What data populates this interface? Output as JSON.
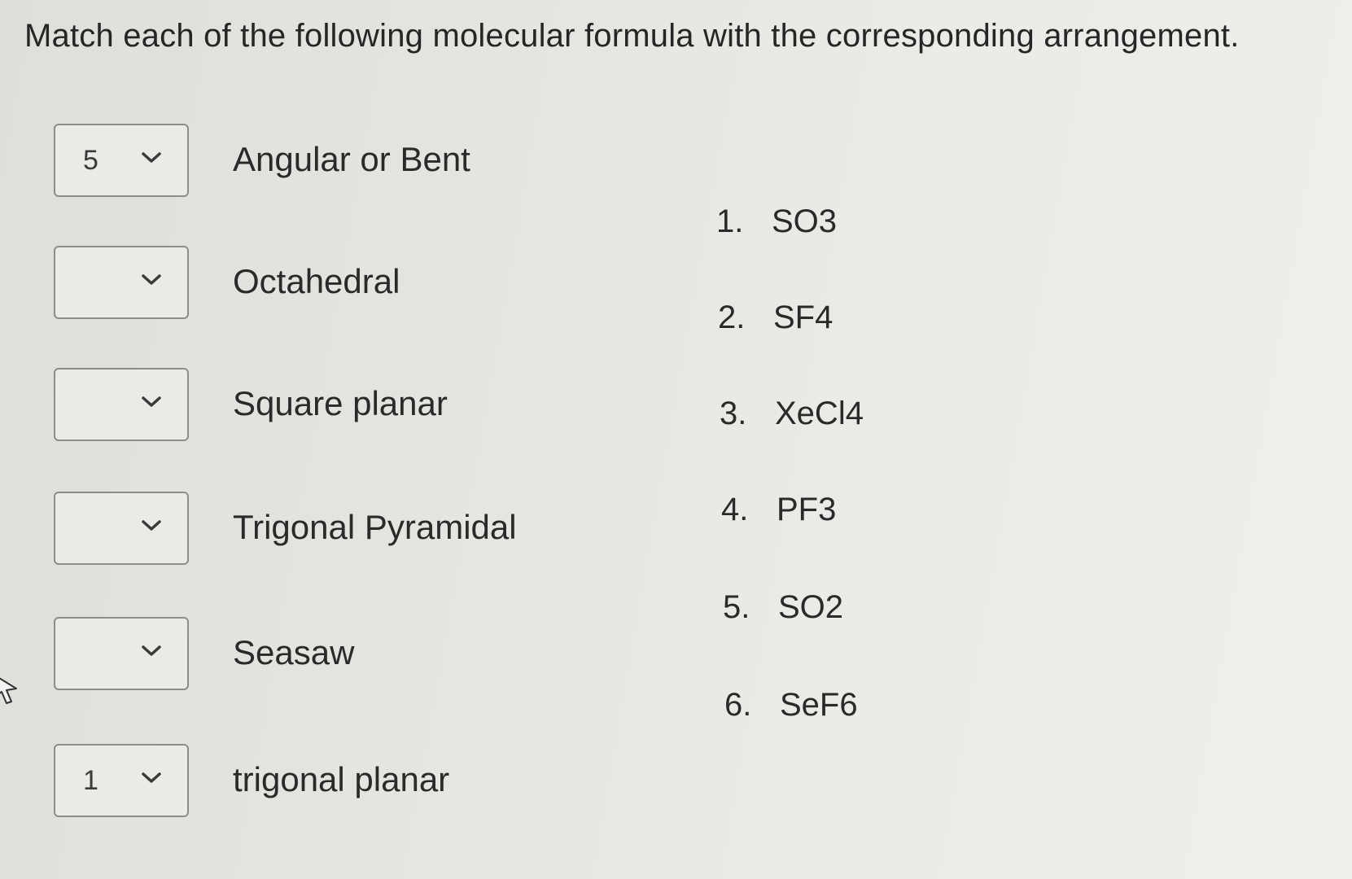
{
  "question": "Match each of the following molecular formula with the corresponding arrangement.",
  "matches": [
    {
      "value": "5",
      "term": "Angular or Bent"
    },
    {
      "value": "",
      "term": "Octahedral"
    },
    {
      "value": "",
      "term": "Square planar"
    },
    {
      "value": "",
      "term": "Trigonal Pyramidal"
    },
    {
      "value": "",
      "term": "Seasaw"
    },
    {
      "value": "1",
      "term": "trigonal planar"
    }
  ],
  "options": [
    {
      "num": "1.",
      "formula": "SO3"
    },
    {
      "num": "2.",
      "formula": "SF4"
    },
    {
      "num": "3.",
      "formula": "XeCl4"
    },
    {
      "num": "4.",
      "formula": "PF3"
    },
    {
      "num": "5.",
      "formula": "SO2"
    },
    {
      "num": "6.",
      "formula": "SeF6"
    }
  ],
  "icons": {
    "dropdown": "chevron-down-icon",
    "cursor": "mouse-pointer-icon"
  },
  "colors": {
    "text": "#2a2a2a",
    "border": "#8c8d8a",
    "background": "#e6e7e2"
  }
}
